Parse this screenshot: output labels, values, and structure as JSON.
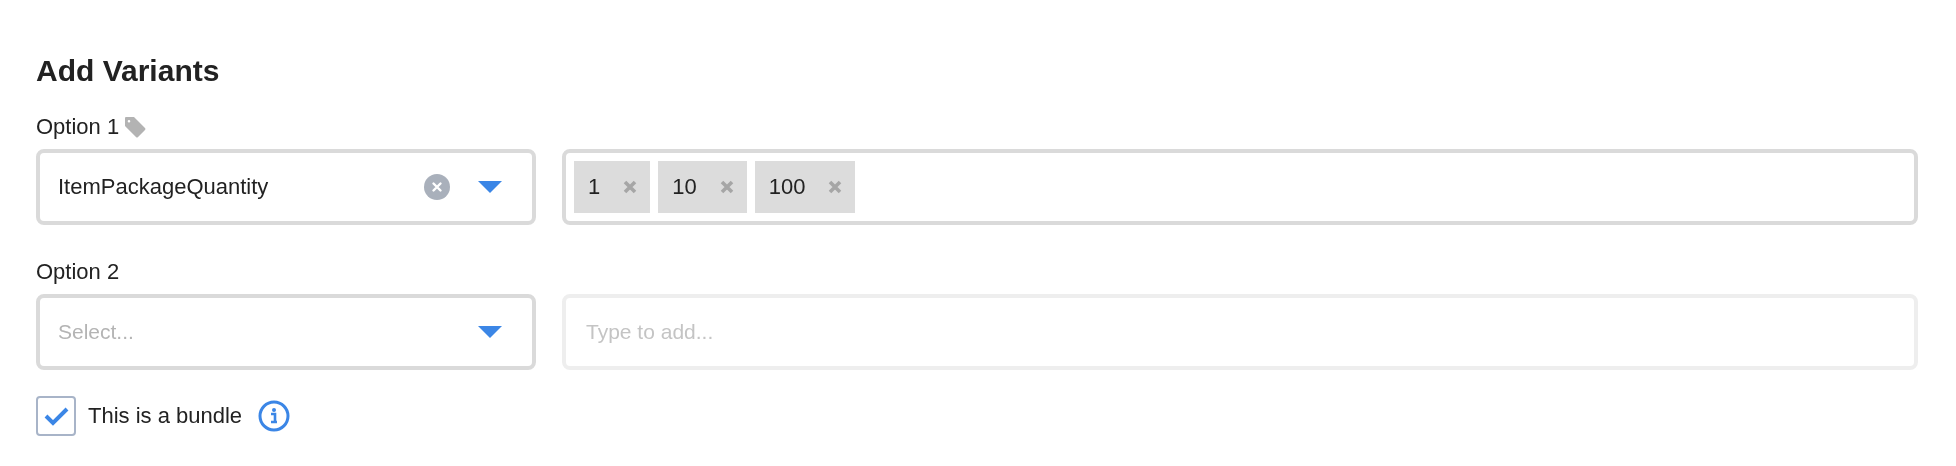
{
  "title": "Add Variants",
  "options": [
    {
      "label": "Option 1",
      "tagged": true,
      "select": {
        "value": "ItemPackageQuantity"
      },
      "values": {
        "disabled": false,
        "tags": [
          "1",
          "10",
          "100"
        ]
      }
    },
    {
      "label": "Option 2",
      "tagged": false,
      "select": {
        "placeholder": "Select..."
      },
      "values": {
        "disabled": true,
        "placeholder": "Type to add..."
      }
    }
  ],
  "bundle": {
    "label": "This is a bundle",
    "checked": true
  }
}
